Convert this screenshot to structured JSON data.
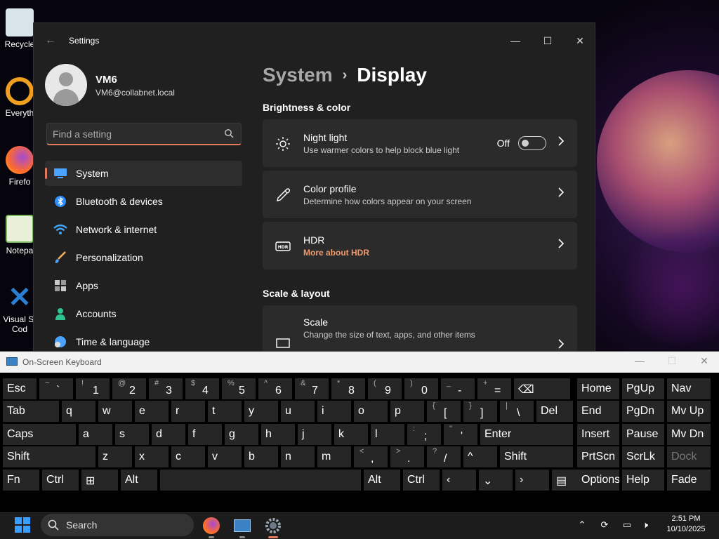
{
  "desktop": {
    "icons": [
      {
        "label": "Recycle",
        "color": "#d9e3ea"
      },
      {
        "label": "Everyth",
        "color": "#f0a020"
      },
      {
        "label": "Firefo",
        "color": "#ff6a2b"
      },
      {
        "label": "Notepa",
        "color": "#7bb661"
      },
      {
        "label": "Visual St",
        "label2": "Cod",
        "color": "#2a7fd4"
      }
    ]
  },
  "settings": {
    "window_title": "Settings",
    "user": {
      "name": "VM6",
      "email": "VM6@collabnet.local"
    },
    "search": {
      "placeholder": "Find a setting"
    },
    "nav": [
      {
        "label": "System",
        "icon": "monitor-icon",
        "color": "#4aa3ff"
      },
      {
        "label": "Bluetooth & devices",
        "icon": "bluetooth-icon",
        "color": "#2f8fff"
      },
      {
        "label": "Network & internet",
        "icon": "wifi-icon",
        "color": "#43a6ff"
      },
      {
        "label": "Personalization",
        "icon": "brush-icon",
        "color": "#f0b060"
      },
      {
        "label": "Apps",
        "icon": "apps-icon",
        "color": "#c8c8c8"
      },
      {
        "label": "Accounts",
        "icon": "person-icon",
        "color": "#2ec28e"
      },
      {
        "label": "Time & language",
        "icon": "globe-clock-icon",
        "color": "#4aa3ff"
      }
    ],
    "breadcrumb": {
      "parent": "System",
      "separator": "›",
      "current": "Display"
    },
    "sections": {
      "brightness": "Brightness & color",
      "scale": "Scale & layout"
    },
    "cards": {
      "night_light": {
        "title": "Night light",
        "subtitle": "Use warmer colors to help block blue light",
        "state": "Off"
      },
      "color_profile": {
        "title": "Color profile",
        "subtitle": "Determine how colors appear on your screen"
      },
      "hdr": {
        "title": "HDR",
        "subtitle": "More about HDR"
      },
      "scale": {
        "title": "Scale",
        "subtitle": "Change the size of text, apps, and other items"
      }
    },
    "accent": "#e07a5f"
  },
  "osk": {
    "title": "On-Screen Keyboard",
    "rows": [
      [
        {
          "m": "Esc"
        },
        {
          "s": "~",
          "l": "`"
        },
        {
          "s": "!",
          "l": "1"
        },
        {
          "s": "@",
          "l": "2"
        },
        {
          "s": "#",
          "l": "3"
        },
        {
          "s": "$",
          "l": "4"
        },
        {
          "s": "%",
          "l": "5"
        },
        {
          "s": "^",
          "l": "6"
        },
        {
          "s": "&",
          "l": "7"
        },
        {
          "s": "*",
          "l": "8"
        },
        {
          "s": "(",
          "l": "9"
        },
        {
          "s": ")",
          "l": "0"
        },
        {
          "s": "_",
          "l": "-"
        },
        {
          "s": "+",
          "l": "="
        },
        {
          "m": "⌫"
        },
        {
          "m": "Home"
        },
        {
          "m": "PgUp"
        },
        {
          "m": "Nav"
        }
      ],
      [
        {
          "m": "Tab"
        },
        {
          "m": "q"
        },
        {
          "m": "w"
        },
        {
          "m": "e"
        },
        {
          "m": "r"
        },
        {
          "m": "t"
        },
        {
          "m": "y"
        },
        {
          "m": "u"
        },
        {
          "m": "i"
        },
        {
          "m": "o"
        },
        {
          "m": "p"
        },
        {
          "s": "{",
          "l": "["
        },
        {
          "s": "}",
          "l": "]"
        },
        {
          "s": "|",
          "l": "\\"
        },
        {
          "m": "Del"
        },
        {
          "m": "End"
        },
        {
          "m": "PgDn"
        },
        {
          "m": "Mv Up"
        }
      ],
      [
        {
          "m": "Caps"
        },
        {
          "m": "a"
        },
        {
          "m": "s"
        },
        {
          "m": "d"
        },
        {
          "m": "f"
        },
        {
          "m": "g"
        },
        {
          "m": "h"
        },
        {
          "m": "j"
        },
        {
          "m": "k"
        },
        {
          "m": "l"
        },
        {
          "s": ":",
          "l": ";"
        },
        {
          "s": "\"",
          "l": "'"
        },
        {
          "m": "Enter"
        },
        {
          "m": "Insert"
        },
        {
          "m": "Pause"
        },
        {
          "m": "Mv Dn"
        }
      ],
      [
        {
          "m": "Shift"
        },
        {
          "m": "z"
        },
        {
          "m": "x"
        },
        {
          "m": "c"
        },
        {
          "m": "v"
        },
        {
          "m": "b"
        },
        {
          "m": "n"
        },
        {
          "m": "m"
        },
        {
          "s": "<",
          "l": ","
        },
        {
          "s": ">",
          "l": "."
        },
        {
          "s": "?",
          "l": "/"
        },
        {
          "m": "^"
        },
        {
          "m": "Shift"
        },
        {
          "m": "PrtScn"
        },
        {
          "m": "ScrLk"
        },
        {
          "m": "Dock",
          "dim": true
        }
      ],
      [
        {
          "m": "Fn"
        },
        {
          "m": "Ctrl"
        },
        {
          "m": "⊞"
        },
        {
          "m": "Alt"
        },
        {
          "m": ""
        },
        {
          "m": "Alt"
        },
        {
          "m": "Ctrl"
        },
        {
          "m": "‹"
        },
        {
          "m": "⌄"
        },
        {
          "m": "›"
        },
        {
          "m": "▤"
        },
        {
          "m": "Options"
        },
        {
          "m": "Help"
        },
        {
          "m": "Fade"
        }
      ]
    ]
  },
  "taskbar": {
    "search_label": "Search",
    "clock": {
      "time": "2:51 PM",
      "date": "10/10/2025"
    },
    "apps": [
      "firefox-icon",
      "keyboard-icon",
      "settings-gear-icon"
    ]
  }
}
